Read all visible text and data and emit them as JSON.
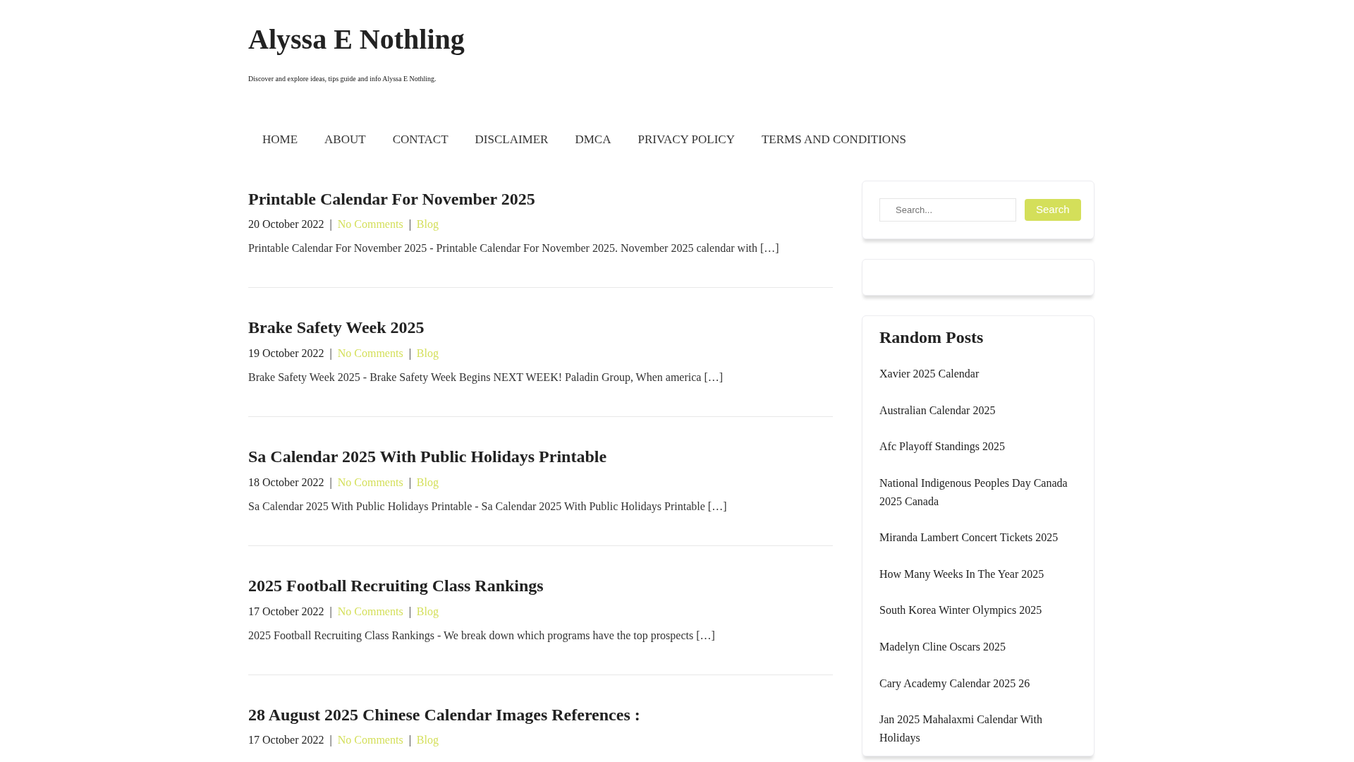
{
  "site": {
    "title": "Alyssa E Nothling",
    "tagline": "Discover and explore ideas, tips guide and info Alyssa E Nothling."
  },
  "nav": [
    {
      "label": "HOME"
    },
    {
      "label": "ABOUT"
    },
    {
      "label": "CONTACT"
    },
    {
      "label": "DISCLAIMER"
    },
    {
      "label": "DMCA"
    },
    {
      "label": "PRIVACY POLICY"
    },
    {
      "label": "TERMS AND CONDITIONS"
    }
  ],
  "posts": [
    {
      "title": "Printable Calendar For November 2025",
      "date": "20 October 2022",
      "separators": [
        "|",
        "|"
      ],
      "comments": "No Comments",
      "category": "Blog",
      "excerpt": "Printable Calendar For November 2025 - Printable Calendar For November 2025. November 2025 calendar with […]"
    },
    {
      "title": "Brake Safety Week 2025",
      "date": "19 October 2022",
      "separators": [
        "|",
        "|"
      ],
      "comments": "No Comments",
      "category": "Blog",
      "excerpt": "Brake Safety Week 2025 - Brake Safety Week Begins NEXT WEEK! Paladin Group, When america […]"
    },
    {
      "title": "Sa Calendar 2025 With Public Holidays Printable",
      "date": "18 October 2022",
      "separators": [
        "|",
        "|"
      ],
      "comments": "No Comments",
      "category": "Blog",
      "excerpt": "Sa Calendar 2025 With Public Holidays Printable - Sa Calendar 2025 With Public Holidays Printable […]"
    },
    {
      "title": "2025 Football Recruiting Class Rankings",
      "date": "17 October 2022",
      "separators": [
        "|",
        "|"
      ],
      "comments": "No Comments",
      "category": "Blog",
      "excerpt": "2025 Football Recruiting Class Rankings - We break down which programs have the top prospects […]"
    },
    {
      "title": "28 August 2025 Chinese Calendar Images References :",
      "date": "17 October 2022",
      "separators": [
        "|",
        "|"
      ],
      "comments": "No Comments",
      "category": "Blog"
    }
  ],
  "sidebar": {
    "search": {
      "placeholder": "Search...",
      "button": "Search"
    },
    "random_posts": {
      "heading": "Random Posts",
      "items": [
        "Xavier 2025 Calendar",
        "Australian Calendar 2025",
        "Afc Playoff Standings 2025",
        "National Indigenous Peoples Day Canada 2025 Canada",
        "Miranda Lambert Concert Tickets 2025",
        "How Many Weeks In The Year 2025",
        "South Korea Winter Olympics 2025",
        "Madelyn Cline Oscars 2025",
        "Cary Academy Calendar 2025 26",
        "Jan 2025 Mahalaxmi Calendar With Holidays"
      ]
    }
  }
}
